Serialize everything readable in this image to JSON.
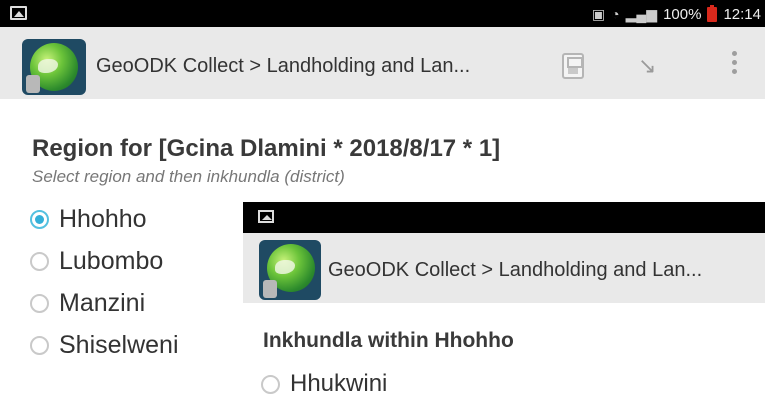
{
  "statusbar": {
    "signal_text": "ℵ$",
    "battery": "100%",
    "time": "12:14"
  },
  "toolbar": {
    "title": "GeoODK Collect > Landholding and Lan..."
  },
  "question": {
    "label": "Region for [Gcina Dlamini * 2018/8/17 * 1]",
    "hint": "Select region and then inkhundla (district)",
    "choices": [
      {
        "label": "Hhohho",
        "selected": true
      },
      {
        "label": "Lubombo",
        "selected": false
      },
      {
        "label": "Manzini",
        "selected": false
      },
      {
        "label": "Shiselweni",
        "selected": false
      }
    ]
  },
  "inset": {
    "toolbar_title": "GeoODK Collect > Landholding and Lan...",
    "question": "Inkhundla within Hhohho",
    "choices": [
      {
        "label": "Hhukwini",
        "selected": false
      }
    ]
  },
  "colors": {
    "radio_selected": "#34b0d9",
    "toolbar_bg": "#e9e9e9",
    "statusbar_bg": "#000000"
  }
}
